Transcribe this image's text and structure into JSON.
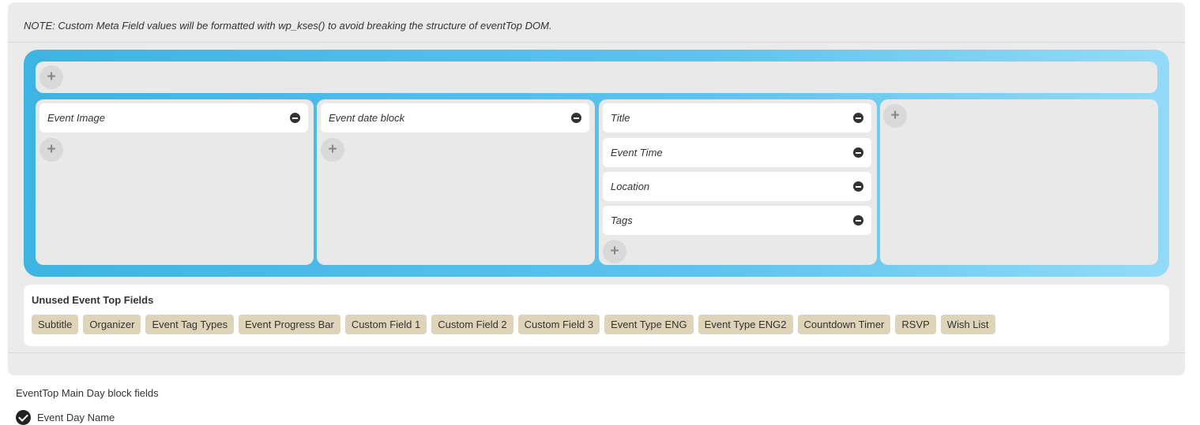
{
  "note": "NOTE: Custom Meta Field values will be formatted with wp_kses() to avoid breaking the structure of eventTop DOM.",
  "icons": {
    "add": "plus-icon",
    "remove": "minus-circle-icon",
    "checked": "checkmark-circle-icon"
  },
  "colors": {
    "layout_gradient_start": "#3db4e3",
    "layout_gradient_end": "#93dbf8",
    "tag_bg": "#ddd4b9"
  },
  "add_symbol": "+",
  "layout": {
    "columns": [
      {
        "fields": [
          "Event Image"
        ]
      },
      {
        "fields": [
          "Event date block"
        ]
      },
      {
        "fields": [
          "Title",
          "Event Time",
          "Location",
          "Tags"
        ]
      },
      {
        "fields": []
      }
    ]
  },
  "unused": {
    "title": "Unused Event Top Fields",
    "tags": [
      "Subtitle",
      "Organizer",
      "Event Tag Types",
      "Event Progress Bar",
      "Custom Field 1",
      "Custom Field 2",
      "Custom Field 3",
      "Event Type ENG",
      "Event Type ENG2",
      "Countdown Timer",
      "RSVP",
      "Wish List"
    ]
  },
  "main_day": {
    "title": "EventTop Main Day block fields",
    "items": [
      {
        "label": "Event Day Name",
        "checked": true
      }
    ]
  }
}
